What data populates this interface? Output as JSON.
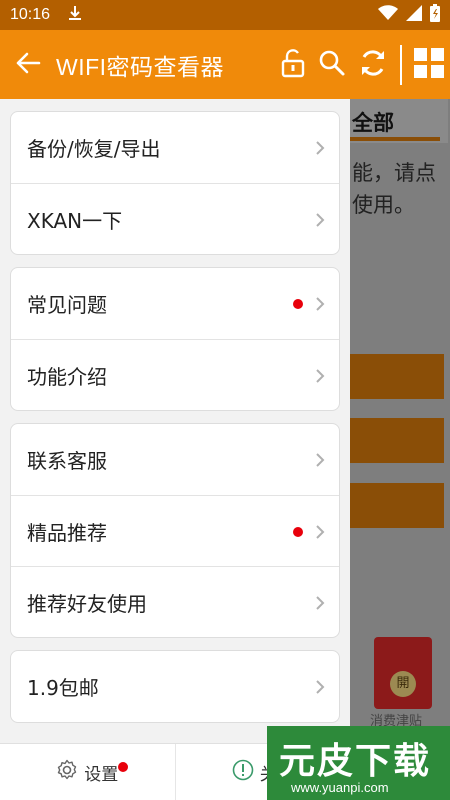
{
  "status_bar": {
    "time": "10:16"
  },
  "app_bar": {
    "title": "WIFI密码查看器"
  },
  "background": {
    "tab_label": "全部",
    "text_line1": "能，请点",
    "text_line2": "使用。",
    "redpacket_label": "開",
    "bottom_text": "消费津贴"
  },
  "drawer": {
    "groups": [
      {
        "items": [
          {
            "label": "备份/恢复/导出",
            "dot": false
          },
          {
            "label": "XKAN一下",
            "dot": false
          }
        ]
      },
      {
        "items": [
          {
            "label": "常见问题",
            "dot": true
          },
          {
            "label": "功能介绍",
            "dot": false
          }
        ]
      },
      {
        "items": [
          {
            "label": "联系客服",
            "dot": false
          },
          {
            "label": "精品推荐",
            "dot": true
          },
          {
            "label": "推荐好友使用",
            "dot": false
          }
        ]
      },
      {
        "items": [
          {
            "label": "1.9包邮",
            "dot": false
          }
        ]
      }
    ]
  },
  "bottom_bar": {
    "settings_label": "设置",
    "about_label": "关于"
  },
  "watermark": {
    "title": "元皮下载",
    "url": "www.yuanpi.com"
  },
  "colors": {
    "accent": "#f08a0a",
    "status_bar": "#b35f00",
    "notification_dot": "#e8000b"
  }
}
